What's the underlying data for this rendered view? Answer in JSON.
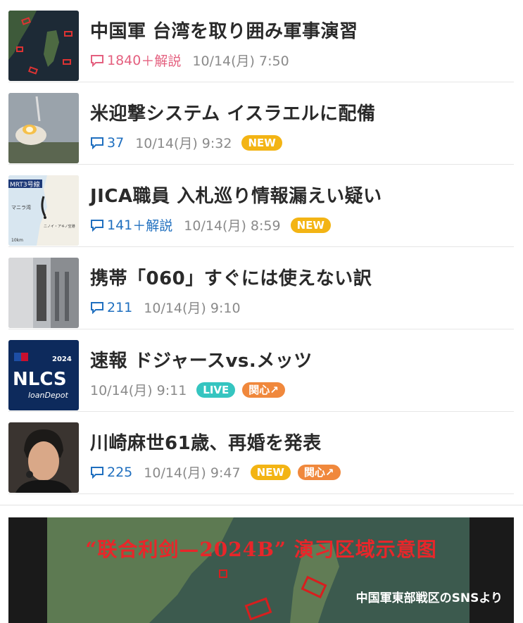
{
  "articles": [
    {
      "title": "中国軍 台湾を取り囲み軍事演習",
      "comments": "1840",
      "sub": "＋解説",
      "date": "10/14(月) 7:50",
      "hot": true,
      "badges": [],
      "thumb": "map-taiwan-thumbnail"
    },
    {
      "title": "米迎撃システム イスラエルに配備",
      "comments": "37",
      "sub": "",
      "date": "10/14(月) 9:32",
      "hot": false,
      "badges": [
        "NEW"
      ],
      "thumb": "missile-launch-thumbnail"
    },
    {
      "title": "JICA職員 入札巡り情報漏えい疑い",
      "comments": "141",
      "sub": "＋解説",
      "date": "10/14(月) 8:59",
      "hot": false,
      "badges": [
        "NEW"
      ],
      "thumb": "metro-map-thumbnail"
    },
    {
      "title": "携帯「060」すぐには使えない訳",
      "comments": "211",
      "sub": "",
      "date": "10/14(月) 9:10",
      "hot": false,
      "badges": [],
      "thumb": "building-thumbnail"
    },
    {
      "title": "速報 ドジャースvs.メッツ",
      "comments": "",
      "sub": "",
      "date": "10/14(月) 9:11",
      "hot": false,
      "badges": [
        "LIVE",
        "関心↗"
      ],
      "thumb": "nlcs-logo-thumbnail"
    },
    {
      "title": "川崎麻世61歳、再婚を発表",
      "comments": "225",
      "sub": "",
      "date": "10/14(月) 9:47",
      "hot": false,
      "badges": [
        "NEW",
        "関心↗"
      ],
      "thumb": "portrait-thumbnail"
    }
  ],
  "thumb_text": {
    "metro_label": "MRT3号線",
    "metro_place1": "マニラ湾",
    "metro_place2": "ニノイ・アキノ空港",
    "metro_scale": "10km",
    "nlcs_year": "2024",
    "nlcs_main": "NLCS",
    "nlcs_sponsor": "loanDepot"
  },
  "bottom": {
    "title": "“联合利剑—2024B” 演习区域示意图",
    "caption": "中国軍東部戦区のSNSより"
  }
}
